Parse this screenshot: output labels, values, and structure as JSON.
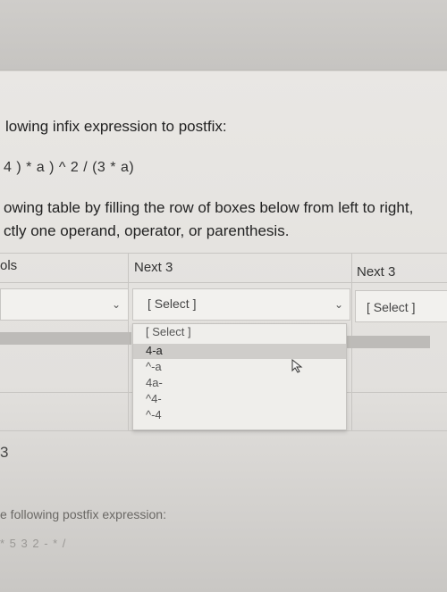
{
  "question1": {
    "prompt": "lowing infix expression to postfix:",
    "expression": "4 ) * a ) ^ 2  / (3 * a)",
    "instructions_line1": "owing table by filling the row of boxes below from left to right, ",
    "instructions_line2": "ctly one operand, operator, or parenthesis."
  },
  "table": {
    "headers": [
      "ols",
      "Next 3",
      "Next 3"
    ],
    "selects": [
      "",
      "[ Select ]",
      "[ Select ]"
    ]
  },
  "dropdown": {
    "options": [
      "[ Select ]",
      "4-a",
      "^-a",
      "4a-",
      "^4-",
      "^-4"
    ],
    "highlighted_index": 1
  },
  "question2": {
    "number": "3",
    "prompt": "e following postfix expression:",
    "expression": "* 5 3 2 - * /"
  },
  "colors": {
    "background": "#e9e7e4",
    "highlight": "#cfcdca"
  }
}
